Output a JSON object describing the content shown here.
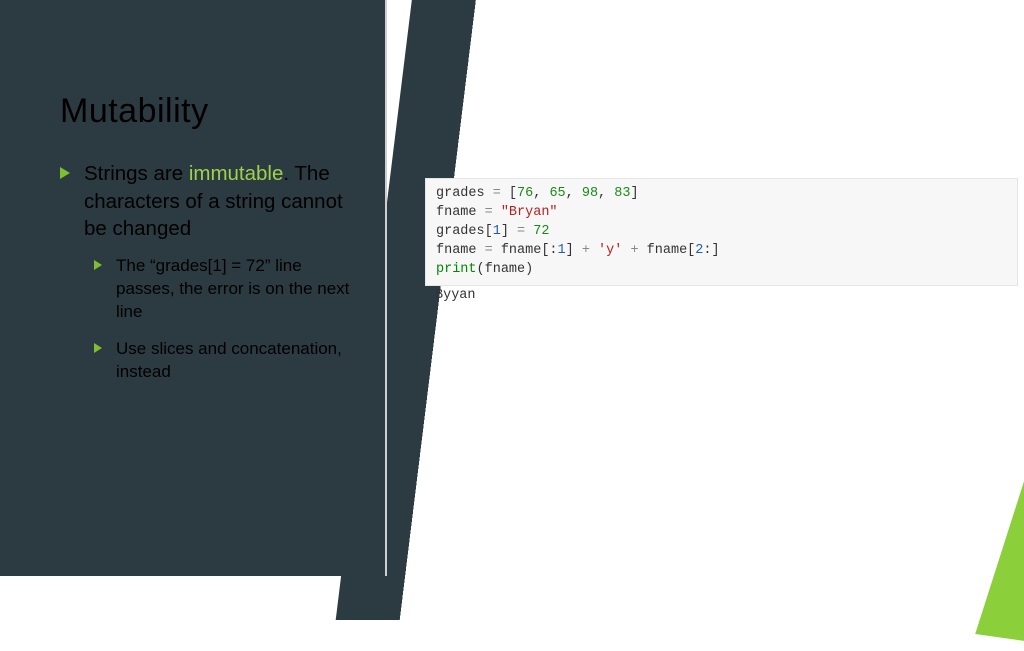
{
  "slide": {
    "title": "Mutability",
    "bullet1_prefix": "Strings are ",
    "bullet1_highlight": "immutable",
    "bullet1_suffix": ". The characters of a string cannot be changed",
    "sub1": "The “grades[1] = 72” line passes, the error is on the next line",
    "sub2": "Use slices and concatenation, instead"
  },
  "code": {
    "line1": {
      "a": "grades ",
      "op": "= ",
      "b": "[",
      "n1": "76",
      "c1": ", ",
      "n2": "65",
      "c2": ", ",
      "n3": "98",
      "c3": ", ",
      "n4": "83",
      "d": "]"
    },
    "line2": {
      "a": "fname ",
      "op": "= ",
      "s": "\"Bryan\""
    },
    "line3": {
      "a": "grades[",
      "i": "1",
      "b": "] ",
      "op": "= ",
      "n": "72"
    },
    "line4": {
      "a": "fname ",
      "op": "= ",
      "b": "fname[:",
      "i1": "1",
      "c": "] ",
      "plus1": "+ ",
      "s": "'y'",
      "plus2": " + ",
      "d": "fname[",
      "i2": "2",
      "e": ":]"
    },
    "line5": {
      "fn": "print",
      "a": "(fname)"
    }
  },
  "output": "Byyan"
}
